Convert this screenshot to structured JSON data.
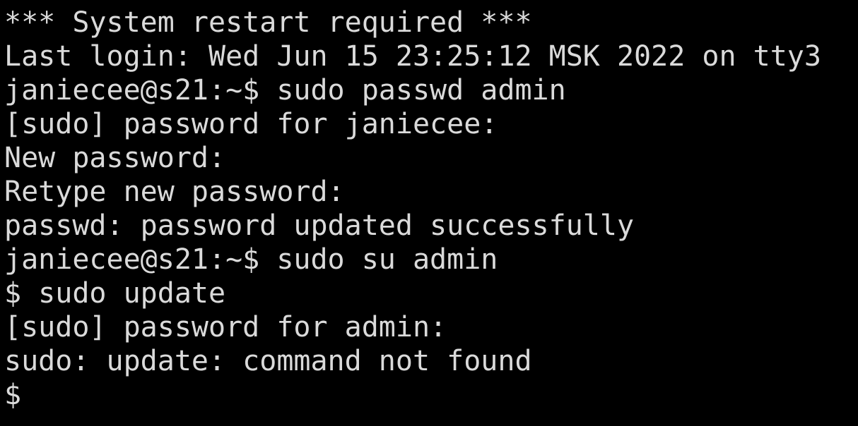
{
  "terminal": {
    "lines": [
      "*** System restart required ***",
      "Last login: Wed Jun 15 23:25:12 MSK 2022 on tty3",
      "janiecee@s21:~$ sudo passwd admin",
      "[sudo] password for janiecee:",
      "New password:",
      "Retype new password:",
      "passwd: password updated successfully",
      "janiecee@s21:~$ sudo su admin",
      "$ sudo update",
      "[sudo] password for admin:",
      "sudo: update: command not found"
    ],
    "current_prompt": "$ "
  },
  "colors": {
    "background": "#000000",
    "foreground": "#dadada"
  }
}
